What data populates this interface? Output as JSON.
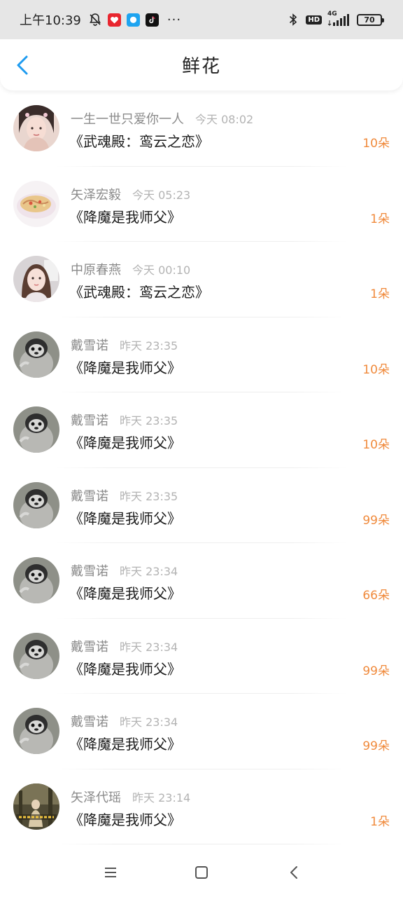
{
  "status_bar": {
    "time": "上午10:39",
    "more": "···",
    "battery": "70",
    "network": "4G",
    "hd": "HD",
    "icons": [
      "notifications-off-icon",
      "red-app-icon",
      "blue-chat-app-icon",
      "tiktok-icon",
      "bluetooth-icon",
      "hd-icon",
      "signal-icon",
      "battery-icon"
    ]
  },
  "header": {
    "title": "鲜花",
    "back_icon": "chevron-left-icon"
  },
  "colors": {
    "accent": "#1e9bf0",
    "count": "#f08a3c",
    "username": "#8a8a8a",
    "time": "#b3b3b3"
  },
  "records": [
    {
      "username": "一生一世只爱你一人",
      "time": "今天 08:02",
      "book": "《武魂殿：鸾云之恋》",
      "count": "10朵",
      "avatar": "girl-portrait"
    },
    {
      "username": "矢泽宏毅",
      "time": "今天 05:23",
      "book": "《降魔是我师父》",
      "count": "1朵",
      "avatar": "food-plate"
    },
    {
      "username": "中原春燕",
      "time": "今天 00:10",
      "book": "《武魂殿：鸾云之恋》",
      "count": "1朵",
      "avatar": "girl-selfie"
    },
    {
      "username": "戴雪诺",
      "time": "昨天 23:35",
      "book": "《降魔是我师父》",
      "count": "10朵",
      "avatar": "penguin"
    },
    {
      "username": "戴雪诺",
      "time": "昨天 23:35",
      "book": "《降魔是我师父》",
      "count": "10朵",
      "avatar": "penguin"
    },
    {
      "username": "戴雪诺",
      "time": "昨天 23:35",
      "book": "《降魔是我师父》",
      "count": "99朵",
      "avatar": "penguin"
    },
    {
      "username": "戴雪诺",
      "time": "昨天 23:34",
      "book": "《降魔是我师父》",
      "count": "66朵",
      "avatar": "penguin"
    },
    {
      "username": "戴雪诺",
      "time": "昨天 23:34",
      "book": "《降魔是我师父》",
      "count": "99朵",
      "avatar": "penguin"
    },
    {
      "username": "戴雪诺",
      "time": "昨天 23:34",
      "book": "《降魔是我师父》",
      "count": "99朵",
      "avatar": "penguin"
    },
    {
      "username": "矢泽代瑶",
      "time": "昨天 23:14",
      "book": "《降魔是我师父》",
      "count": "1朵",
      "avatar": "forest-figure"
    }
  ],
  "nav_bar": {
    "icons": [
      "menu-icon",
      "home-icon",
      "back-icon"
    ]
  }
}
